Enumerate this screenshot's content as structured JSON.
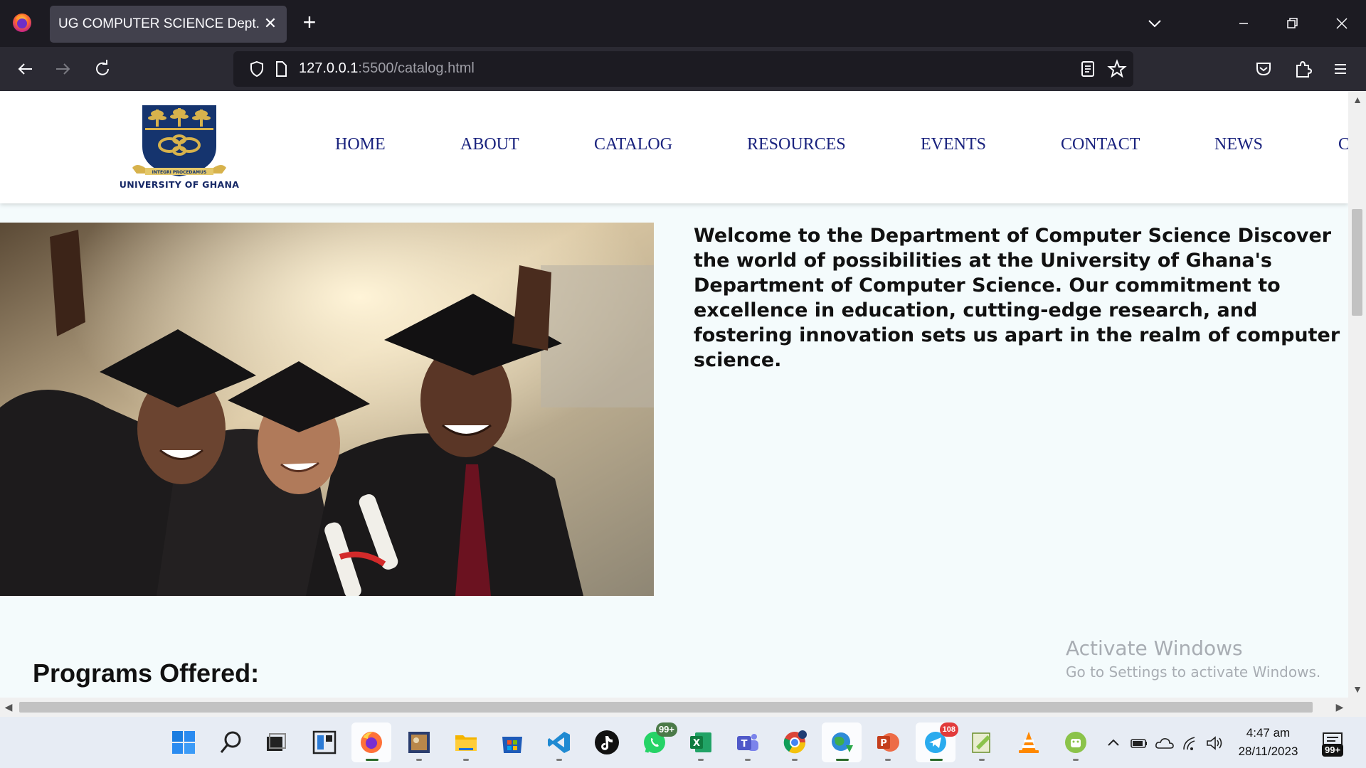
{
  "browser": {
    "tab_title": "UG COMPUTER SCIENCE Dept.",
    "url_host": "127.0.0.1",
    "url_rest": ":5500/catalog.html"
  },
  "site": {
    "logo_text": "UNIVERSITY OF GHANA",
    "logo_motto": "INTEGRI PROCEDAMUS",
    "nav": [
      {
        "label": "HOME"
      },
      {
        "label": "ABOUT"
      },
      {
        "label": "CATALOG"
      },
      {
        "label": "RESOURCES"
      },
      {
        "label": "EVENTS"
      },
      {
        "label": "CONTACT"
      },
      {
        "label": "NEWS"
      },
      {
        "label": "C"
      }
    ],
    "welcome_text": "Welcome to the Department of Computer Science Discover the world of possibilities at the University of Ghana's Department of Computer Science. Our commitment to excellence in education, cutting-edge research, and fostering innovation sets us apart in the realm of computer science.",
    "programs_heading": "Programs Offered:"
  },
  "watermark": {
    "title": "Activate Windows",
    "subtitle": "Go to Settings to activate Windows."
  },
  "taskbar": {
    "whatsapp_badge": "99+",
    "telegram_badge": "108",
    "time": "4:47 am",
    "date": "28/11/2023",
    "notification_badge": "99+"
  },
  "colors": {
    "nav_link": "#1a237e",
    "page_bg": "#f4fbfc",
    "tab_bg": "#42414d"
  }
}
